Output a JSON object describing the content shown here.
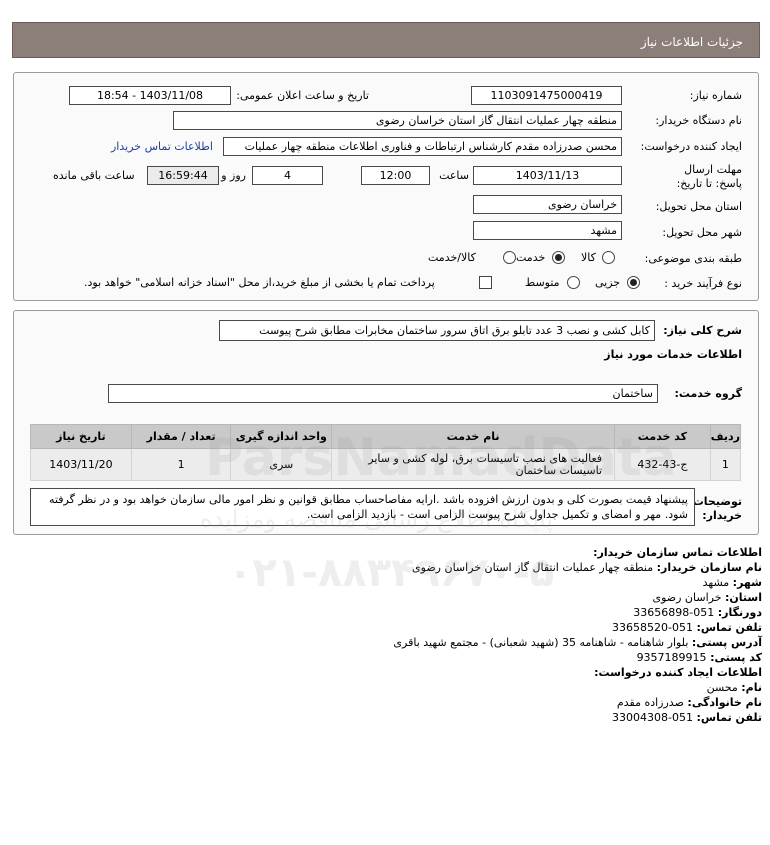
{
  "page_title": "جزئیات اطلاعات نیاز",
  "need": {
    "need_number_label": "شماره نیاز:",
    "need_number": "1103091475000419",
    "announce_label": "تاریخ و ساعت اعلان عمومی:",
    "announce_value": "1403/11/08 - 18:54",
    "buyer_label": "نام دستگاه خریدار:",
    "buyer_value": "منطقه چهار عملیات انتقال گاز   استان خراسان رضوی",
    "creator_label": "ایجاد کننده درخواست:",
    "creator_value": "محسن صدرزاده مقدم کارشناس ارتباطات و فناوری اطلاعات منطقه چهار عملیات",
    "contact_link": "اطلاعات تماس خریدار",
    "deadline_label": "مهلت ارسال پاسخ: تا تاریخ:",
    "deadline_date": "1403/11/13",
    "time_label": "ساعت",
    "deadline_time": "12:00",
    "days_value": "4",
    "days_label": "روز و",
    "remaining_time": "16:59:44",
    "remaining_label": "ساعت باقی مانده",
    "province_label": "استان محل تحویل:",
    "province_value": "خراسان رضوی",
    "city_label": "شهر محل تحویل:",
    "city_value": "مشهد",
    "category_label": "طبقه بندی موضوعی:",
    "category_options": [
      "کالا",
      "خدمت",
      "کالا/خدمت"
    ],
    "category_selected": "خدمت",
    "process_label": "نوع فرآیند خرید :",
    "process_options": [
      "جزیی",
      "متوسط"
    ],
    "process_selected": "جزیی",
    "payment_note": "پرداخت تمام یا بخشی از مبلغ خرید،از محل \"اسناد خزانه اسلامی\" خواهد بود."
  },
  "details": {
    "summary_label": "شرح کلی نیاز:",
    "summary_value": "کابل کشی و نصب 3 عدد تابلو برق اتاق سرور ساختمان مخابرات مطابق شرح پیوست",
    "services_title": "اطلاعات خدمات مورد نیاز",
    "group_label": "گروه خدمت:",
    "group_value": "ساختمان",
    "table": {
      "headers": [
        "ردیف",
        "کد خدمت",
        "نام خدمت",
        "واحد اندازه گیری",
        "تعداد / مقدار",
        "تاریخ نیاز"
      ],
      "rows": [
        [
          "1",
          "ج-43-432",
          "فعالیت های نصب تاسیسات برق، لوله کشی و سایر تاسیسات ساختمان",
          "سری",
          "1",
          "1403/11/20"
        ]
      ]
    },
    "buyer_notes_label": "توضیحات خریدار:",
    "buyer_notes": "پیشنهاد قیمت بصورت کلی و بدون ارزش افزوده باشد .ارایه مفاصاحساب مطابق قوانین و نظر امور مالی سازمان خواهد بود و در نظر گرفته شود. مهر و امضای و تکمیل جداول شرح پیوست الزامی است - بازدید الزامی است."
  },
  "contact": {
    "title": "اطلاعات تماس سازمان خریدار:",
    "org_label": "نام سازمان خریدار:",
    "org_value": "منطقه چهار عملیات انتقال گاز استان خراسان رضوی",
    "city_label": "شهر:",
    "city_value": "مشهد",
    "province_label": "استان:",
    "province_value": "خراسان رضوی",
    "fax_label": "دورنگار:",
    "fax_value": "051-33656898",
    "phone_label": "تلفن تماس:",
    "phone_value": "051-33658520",
    "address_label": "آدرس پستی:",
    "address_value": "بلوار شاهنامه - شاهنامه 35 (شهید شعبانی) - مجتمع شهید باقری",
    "postal_label": "کد پستی:",
    "postal_value": "9357189915",
    "creator_title": "اطلاعات ایجاد کننده درخواست:",
    "first_name_label": "نام:",
    "first_name_value": "محسن",
    "last_name_label": "نام خانوادگی:",
    "last_name_value": "صدرزاده مقدم",
    "creator_phone_label": "تلفن تماس:",
    "creator_phone_value": "051-33004308"
  },
  "watermark": {
    "brand": "ParsNamadData",
    "line1": "پایگاه اطلاع رسانی مناقصه ومزایده",
    "phone": "۰۲۱-۸۸۳۴۹۶۷۰-۵"
  }
}
